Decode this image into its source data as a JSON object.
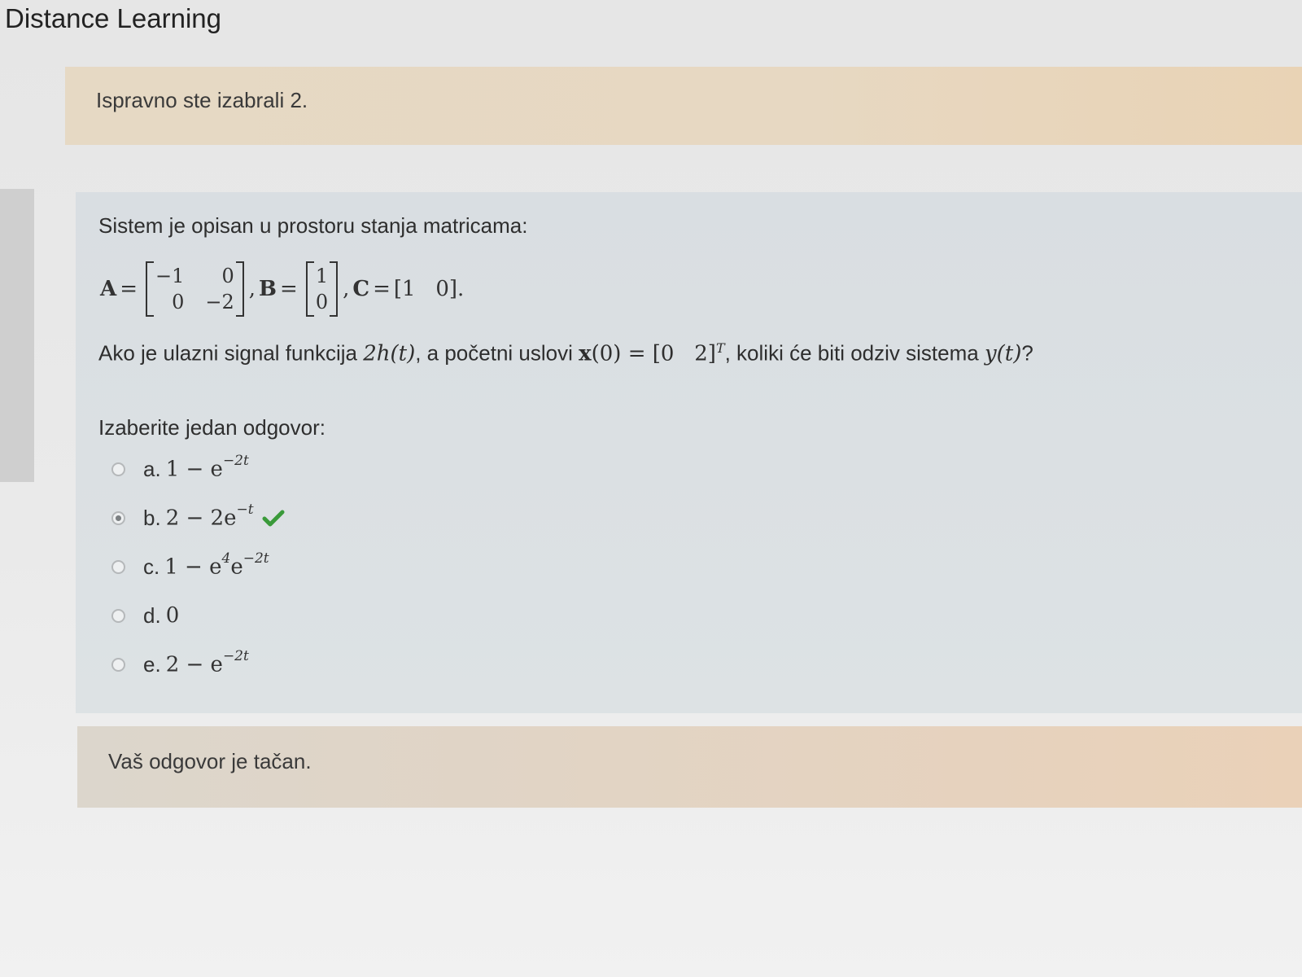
{
  "site": {
    "title": "Distance Learning"
  },
  "feedback_top": {
    "text": "Ispravno ste izabrali 2."
  },
  "question": {
    "intro": "Sistem je opisan u prostoru stanja matricama:",
    "A_label": "A",
    "A": [
      "−1",
      "0",
      "0",
      "−2"
    ],
    "B_label": "B",
    "B": [
      "1",
      "0"
    ],
    "C_label": "C",
    "C_value": "[1   0]",
    "eq": "=",
    "comma": ",",
    "period": ".",
    "sentence_part1": "Ako je ulazni signal funkcija ",
    "input_signal": "2h(t)",
    "sentence_part2": ", a  početni uslovi ",
    "initial_state_lhs": "x",
    "initial_state_rhs": "(0) = [0   2]",
    "transpose": "T",
    "sentence_part3": ", koliki će biti odziv sistema ",
    "output_signal": "y(t)",
    "sentence_end": "?",
    "prompt": "Izaberite jedan odgovor:"
  },
  "options": [
    {
      "letter": "a.",
      "base": "1 − e",
      "exp": "−2t",
      "checked": false
    },
    {
      "letter": "b.",
      "base": "2 − 2e",
      "exp": "−t",
      "checked": true,
      "mark": "check-icon"
    },
    {
      "letter": "c.",
      "base": "1 − e",
      "exp1": "4",
      "mid": "e",
      "exp": "−2t",
      "checked": false
    },
    {
      "letter": "d.",
      "base": "0",
      "checked": false
    },
    {
      "letter": "e.",
      "base": "2 − e",
      "exp": "−2t",
      "checked": false
    }
  ],
  "feedback_bottom": {
    "text": "Vaš odgovor je tačan."
  },
  "colors": {
    "correct_check": "#3a9a3a",
    "feedback_bg": "#e6d6c0",
    "question_bg": "#dadfe2"
  }
}
